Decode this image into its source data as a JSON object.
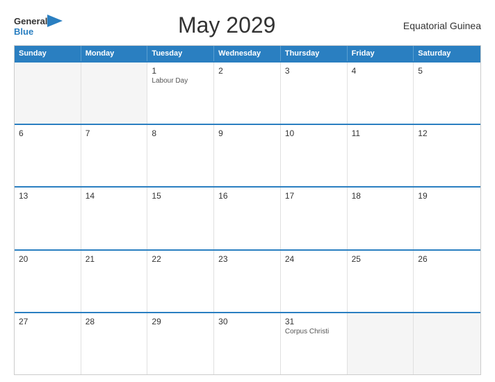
{
  "header": {
    "logo_general": "General",
    "logo_blue": "Blue",
    "title": "May 2029",
    "country": "Equatorial Guinea"
  },
  "calendar": {
    "days_of_week": [
      "Sunday",
      "Monday",
      "Tuesday",
      "Wednesday",
      "Thursday",
      "Friday",
      "Saturday"
    ],
    "weeks": [
      [
        {
          "day": "",
          "empty": true
        },
        {
          "day": "",
          "empty": true
        },
        {
          "day": "1",
          "event": "Labour Day"
        },
        {
          "day": "2",
          "event": ""
        },
        {
          "day": "3",
          "event": ""
        },
        {
          "day": "4",
          "event": ""
        },
        {
          "day": "5",
          "event": ""
        }
      ],
      [
        {
          "day": "6",
          "event": ""
        },
        {
          "day": "7",
          "event": ""
        },
        {
          "day": "8",
          "event": ""
        },
        {
          "day": "9",
          "event": ""
        },
        {
          "day": "10",
          "event": ""
        },
        {
          "day": "11",
          "event": ""
        },
        {
          "day": "12",
          "event": ""
        }
      ],
      [
        {
          "day": "13",
          "event": ""
        },
        {
          "day": "14",
          "event": ""
        },
        {
          "day": "15",
          "event": ""
        },
        {
          "day": "16",
          "event": ""
        },
        {
          "day": "17",
          "event": ""
        },
        {
          "day": "18",
          "event": ""
        },
        {
          "day": "19",
          "event": ""
        }
      ],
      [
        {
          "day": "20",
          "event": ""
        },
        {
          "day": "21",
          "event": ""
        },
        {
          "day": "22",
          "event": ""
        },
        {
          "day": "23",
          "event": ""
        },
        {
          "day": "24",
          "event": ""
        },
        {
          "day": "25",
          "event": ""
        },
        {
          "day": "26",
          "event": ""
        }
      ],
      [
        {
          "day": "27",
          "event": ""
        },
        {
          "day": "28",
          "event": ""
        },
        {
          "day": "29",
          "event": ""
        },
        {
          "day": "30",
          "event": ""
        },
        {
          "day": "31",
          "event": "Corpus Christi"
        },
        {
          "day": "",
          "empty": true
        },
        {
          "day": "",
          "empty": true
        }
      ]
    ]
  }
}
